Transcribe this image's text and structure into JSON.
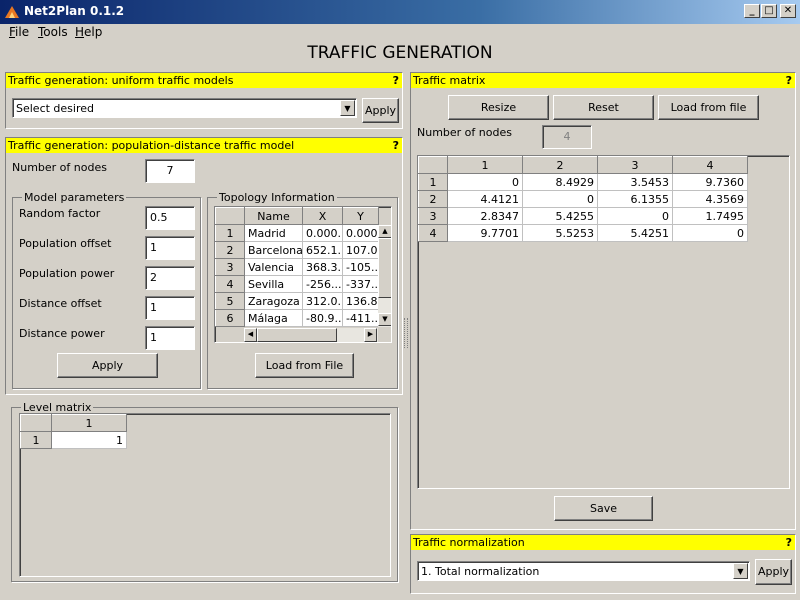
{
  "window": {
    "title": "Net2Plan 0.1.2",
    "min_icon": "minimize-icon",
    "max_icon": "maximize-icon",
    "close_icon": "close-icon"
  },
  "menu": [
    "File",
    "Tools",
    "Help"
  ],
  "main_title": "TRAFFIC GENERATION",
  "help_mark": "?",
  "uniform": {
    "header": "Traffic generation: uniform traffic models",
    "select_value": "Select desired",
    "apply_label": "Apply"
  },
  "popdist": {
    "header": "Traffic generation: population-distance traffic model",
    "num_nodes_label": "Number of nodes",
    "num_nodes_value": "7",
    "model_params": {
      "title": "Model parameters",
      "random_factor_label": "Random factor",
      "random_factor_value": "0.5",
      "pop_offset_label": "Population offset",
      "pop_offset_value": "1",
      "pop_power_label": "Population power",
      "pop_power_value": "2",
      "dist_offset_label": "Distance offset",
      "dist_offset_value": "1",
      "dist_power_label": "Distance power",
      "dist_power_value": "1",
      "apply_label": "Apply"
    },
    "topology": {
      "title": "Topology Information",
      "columns": [
        "Name",
        "X",
        "Y"
      ],
      "rows": [
        {
          "id": "1",
          "name": "Madrid",
          "x": "0.000...",
          "y": "0.000"
        },
        {
          "id": "2",
          "name": "Barcelona",
          "x": "652.1...",
          "y": "107.0"
        },
        {
          "id": "3",
          "name": "Valencia",
          "x": "368.3...",
          "y": "-105.."
        },
        {
          "id": "4",
          "name": "Sevilla",
          "x": "-256....",
          "y": "-337.."
        },
        {
          "id": "5",
          "name": "Zaragoza",
          "x": "312.0...",
          "y": "136.8"
        },
        {
          "id": "6",
          "name": "Málaga",
          "x": "-80.9...",
          "y": "-411.."
        }
      ],
      "load_label": "Load from File"
    }
  },
  "level_matrix": {
    "title": "Level matrix",
    "column": "1",
    "row": "1",
    "value": "1"
  },
  "traffic_matrix": {
    "header": "Traffic matrix",
    "resize_label": "Resize",
    "reset_label": "Reset",
    "load_label": "Load from file",
    "num_nodes_label": "Number of nodes",
    "num_nodes_value": "4",
    "columns": [
      "1",
      "2",
      "3",
      "4"
    ],
    "rows": [
      {
        "id": "1",
        "values": [
          "0",
          "8.4929",
          "3.5453",
          "9.7360"
        ]
      },
      {
        "id": "2",
        "values": [
          "4.4121",
          "0",
          "6.1355",
          "4.3569"
        ]
      },
      {
        "id": "3",
        "values": [
          "2.8347",
          "5.4255",
          "0",
          "1.7495"
        ]
      },
      {
        "id": "4",
        "values": [
          "9.7701",
          "5.5253",
          "5.4251",
          "0"
        ]
      }
    ],
    "save_label": "Save"
  },
  "normalization": {
    "header": "Traffic normalization",
    "select_value": "1. Total normalization",
    "apply_label": "Apply"
  }
}
